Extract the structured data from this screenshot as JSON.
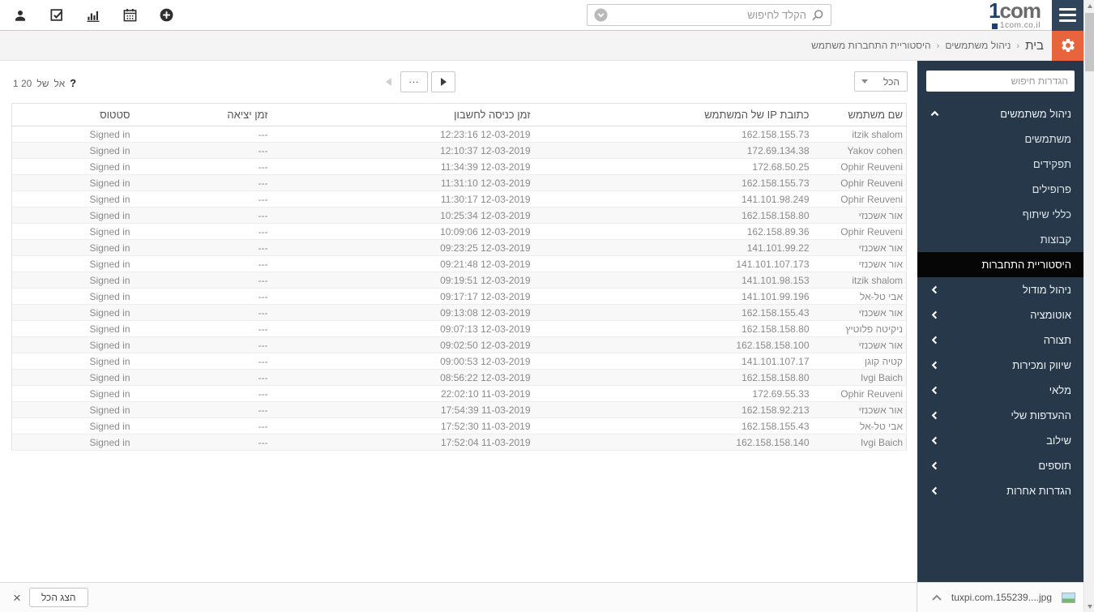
{
  "colors": {
    "accent_orange": "#e8643c",
    "sidebar_bg": "#263849",
    "sidebar_active_bg": "#060606",
    "hamburger_bg": "#30455c",
    "logo_blue": "#1d3e70"
  },
  "topbar": {
    "icons": [
      "user-icon",
      "tasks-check-icon",
      "reports-chart-icon",
      "calendar-icon",
      "add-icon"
    ],
    "search_placeholder": "הקלד לחיפוש",
    "search_icons": [
      "search-icon",
      "chevron-down-circle-icon"
    ]
  },
  "logo": {
    "number": "1",
    "word": "com",
    "domain": "1com.co.il"
  },
  "breadcrumb": {
    "separator": "‹",
    "items": [
      "בית",
      "ניהול משתמשים",
      "היסטוריית התחברות משתמש"
    ]
  },
  "controls": {
    "help_mark": "?",
    "counter_tokens": [
      "1 20",
      "של",
      "אל"
    ],
    "pager_more": "...",
    "filter_value": "הכל"
  },
  "table": {
    "headers": [
      "שם משתמש",
      "כתובת IP של המשתמש",
      "זמן כניסה לחשבון",
      "זמן יציאה",
      "סטטוס"
    ],
    "rows": [
      [
        "itzik shalom",
        "162.158.155.73",
        "12:23:16 12-03-2019",
        "---",
        "Signed in"
      ],
      [
        "Yakov cohen",
        "172.69.134.38",
        "12:10:37 12-03-2019",
        "---",
        "Signed in"
      ],
      [
        "Ophir Reuveni",
        "172.68.50.25",
        "11:34:39 12-03-2019",
        "---",
        "Signed in"
      ],
      [
        "Ophir Reuveni",
        "162.158.155.73",
        "11:31:10 12-03-2019",
        "---",
        "Signed in"
      ],
      [
        "Ophir Reuveni",
        "141.101.98.249",
        "11:30:17 12-03-2019",
        "---",
        "Signed in"
      ],
      [
        "אור אשכנזי",
        "162.158.158.80",
        "10:25:34 12-03-2019",
        "---",
        "Signed in"
      ],
      [
        "Ophir Reuveni",
        "162.158.89.36",
        "10:09:06 12-03-2019",
        "---",
        "Signed in"
      ],
      [
        "אור אשכנזי",
        "141.101.99.22",
        "09:23:25 12-03-2019",
        "---",
        "Signed in"
      ],
      [
        "אור אשכנזי",
        "141.101.107.173",
        "09:21:48 12-03-2019",
        "---",
        "Signed in"
      ],
      [
        "itzik shalom",
        "141.101.98.153",
        "09:19:51 12-03-2019",
        "---",
        "Signed in"
      ],
      [
        "אבי טל-אל",
        "141.101.99.196",
        "09:17:17 12-03-2019",
        "---",
        "Signed in"
      ],
      [
        "אור אשכנזי",
        "162.158.155.43",
        "09:13:08 12-03-2019",
        "---",
        "Signed in"
      ],
      [
        "ניקיטה פלוטיץ",
        "162.158.158.80",
        "09:07:13 12-03-2019",
        "---",
        "Signed in"
      ],
      [
        "אור אשכנזי",
        "162.158.158.100",
        "09:02:50 12-03-2019",
        "---",
        "Signed in"
      ],
      [
        "קטיה קוגן",
        "141.101.107.17",
        "09:00:53 12-03-2019",
        "---",
        "Signed in"
      ],
      [
        "Ivgi Baich",
        "162.158.158.80",
        "08:56:22 12-03-2019",
        "---",
        "Signed in"
      ],
      [
        "Ophir Reuveni",
        "172.69.55.33",
        "22:02:10 11-03-2019",
        "---",
        "Signed in"
      ],
      [
        "אור אשכנזי",
        "162.158.92.213",
        "17:54:39 11-03-2019",
        "---",
        "Signed in"
      ],
      [
        "אבי טל-אל",
        "162.158.155.43",
        "17:52:30 11-03-2019",
        "---",
        "Signed in"
      ],
      [
        "Ivgi Baich",
        "162.158.158.140",
        "17:52:04 11-03-2019",
        "---",
        "Signed in"
      ]
    ]
  },
  "sidebar": {
    "search_placeholder": "הגדרות חיפוש",
    "items": [
      {
        "label": "ניהול משתמשים",
        "type": "group",
        "chevron": "up",
        "active": false
      },
      {
        "label": "משתמשים",
        "type": "sub",
        "chevron": null,
        "active": false
      },
      {
        "label": "תפקידים",
        "type": "sub",
        "chevron": null,
        "active": false
      },
      {
        "label": "פרופילים",
        "type": "sub",
        "chevron": null,
        "active": false
      },
      {
        "label": "כללי שיתוף",
        "type": "sub",
        "chevron": null,
        "active": false
      },
      {
        "label": "קבוצות",
        "type": "sub",
        "chevron": null,
        "active": false
      },
      {
        "label": "היסטוריית התחברות",
        "type": "sub",
        "chevron": null,
        "active": true
      },
      {
        "label": "ניהול מודול",
        "type": "group",
        "chevron": "left",
        "active": false
      },
      {
        "label": "אוטומציה",
        "type": "group",
        "chevron": "left",
        "active": false
      },
      {
        "label": "תצורה",
        "type": "group",
        "chevron": "left",
        "active": false
      },
      {
        "label": "שיווק ומכירות",
        "type": "group",
        "chevron": "left",
        "active": false
      },
      {
        "label": "מלאי",
        "type": "group",
        "chevron": "left",
        "active": false
      },
      {
        "label": "ההעדפות שלי",
        "type": "group",
        "chevron": "left",
        "active": false
      },
      {
        "label": "שילוב",
        "type": "group",
        "chevron": "left",
        "active": false
      },
      {
        "label": "תוספים",
        "type": "group",
        "chevron": "left",
        "active": false
      },
      {
        "label": "הגדרות אחרות",
        "type": "group",
        "chevron": "left",
        "active": false
      }
    ]
  },
  "download_bar": {
    "close_mark": "×",
    "show_all_label": "הצג הכל",
    "file_name": "tuxpi.com.155239....jpg",
    "file_icon": "image-thumbnail-icon"
  }
}
